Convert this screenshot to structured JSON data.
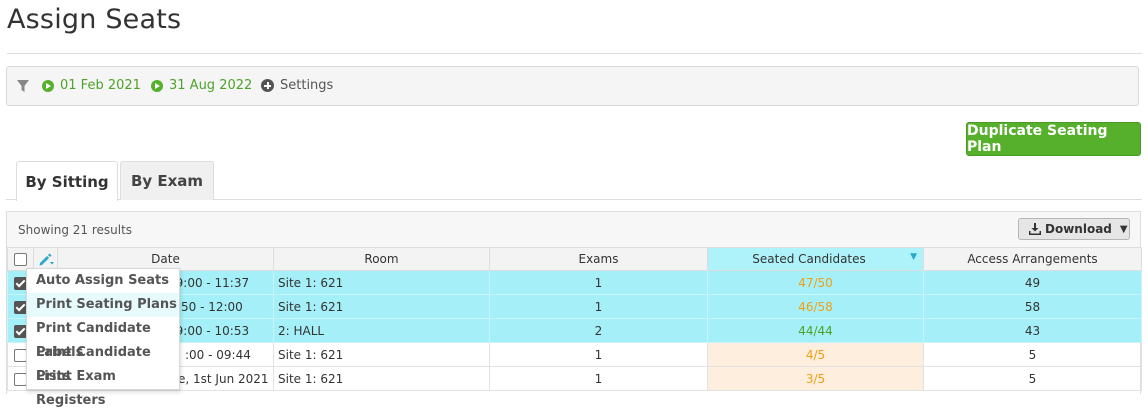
{
  "page": {
    "title": "Assign Seats"
  },
  "filters": {
    "start_date": "01 Feb 2021",
    "end_date": "31 Aug 2022",
    "settings_label": "Settings"
  },
  "actions": {
    "duplicate_label": "Duplicate Seating Plan"
  },
  "tabs": [
    {
      "label": "By Sitting",
      "active": true
    },
    {
      "label": "By Exam",
      "active": false
    }
  ],
  "results": {
    "summary": "Showing 21 results",
    "download_label": "Download"
  },
  "table": {
    "columns": [
      "Date",
      "Room",
      "Exams",
      "Seated Candidates",
      "Access Arrangements"
    ],
    "rows": [
      {
        "checked": true,
        "date": "09:00 - 11:37",
        "room": "Site 1: 621",
        "exams": "1",
        "seated": "47/50",
        "access": "49"
      },
      {
        "checked": true,
        "date": "50 - 12:00",
        "room": "Site 1: 621",
        "exams": "1",
        "seated": "46/58",
        "access": "58"
      },
      {
        "checked": true,
        "date": "09:00 - 10:53",
        "room": "2: HALL",
        "exams": "2",
        "seated": "44/44",
        "access": "43"
      },
      {
        "checked": false,
        "date": ":00 - 09:44",
        "room": "Site 1: 621",
        "exams": "1",
        "seated": "4/5",
        "access": "5"
      },
      {
        "checked": false,
        "date": "e, 1st Jun 2021",
        "room": "Site 1: 621",
        "exams": "1",
        "seated": "3/5",
        "access": "5"
      }
    ]
  },
  "bulk_menu": {
    "items": [
      "Auto Assign Seats",
      "Print Seating Plans",
      "Print Candidate Labels",
      "Print Candidate Lists",
      "Print Exam Registers"
    ]
  },
  "colors": {
    "accent_green": "#56b02c",
    "selected_row": "#a5f0f8",
    "warning_orange": "#f0a015",
    "warning_bg": "#fdeedd"
  }
}
